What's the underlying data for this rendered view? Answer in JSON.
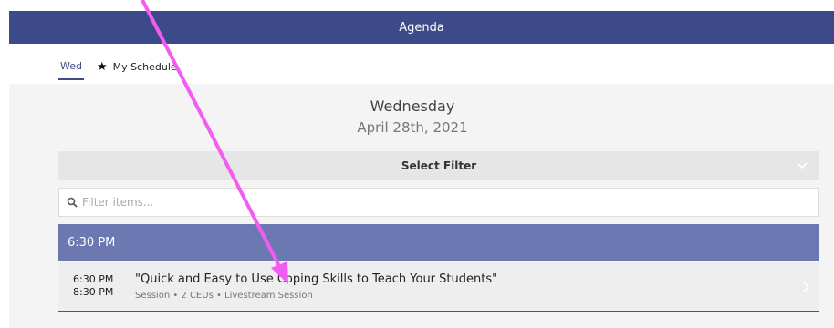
{
  "header": {
    "title": "Agenda",
    "bg_color": "#3d4a8a"
  },
  "tabs": [
    {
      "label": "Wed",
      "active": true
    },
    {
      "label": "My Schedule",
      "icon": "star-icon",
      "active": false
    }
  ],
  "day_heading": {
    "weekday": "Wednesday",
    "date": "April 28th, 2021"
  },
  "filter": {
    "label": "Select Filter",
    "icon": "chevron-down-icon"
  },
  "search": {
    "placeholder": "Filter items...",
    "value": "",
    "icon": "search-icon"
  },
  "time_groups": [
    {
      "label": "6:30 PM",
      "color": "#6c78b2",
      "sessions": [
        {
          "start": "6:30 PM",
          "end": "8:30 PM",
          "title": "\"Quick and Easy to Use Coping Skills to Teach Your Students\"",
          "meta": "Session • 2 CEUs • Livestream Session"
        }
      ]
    }
  ],
  "annotation": {
    "color": "#f25cf0",
    "icon": "arrow-annotation"
  }
}
